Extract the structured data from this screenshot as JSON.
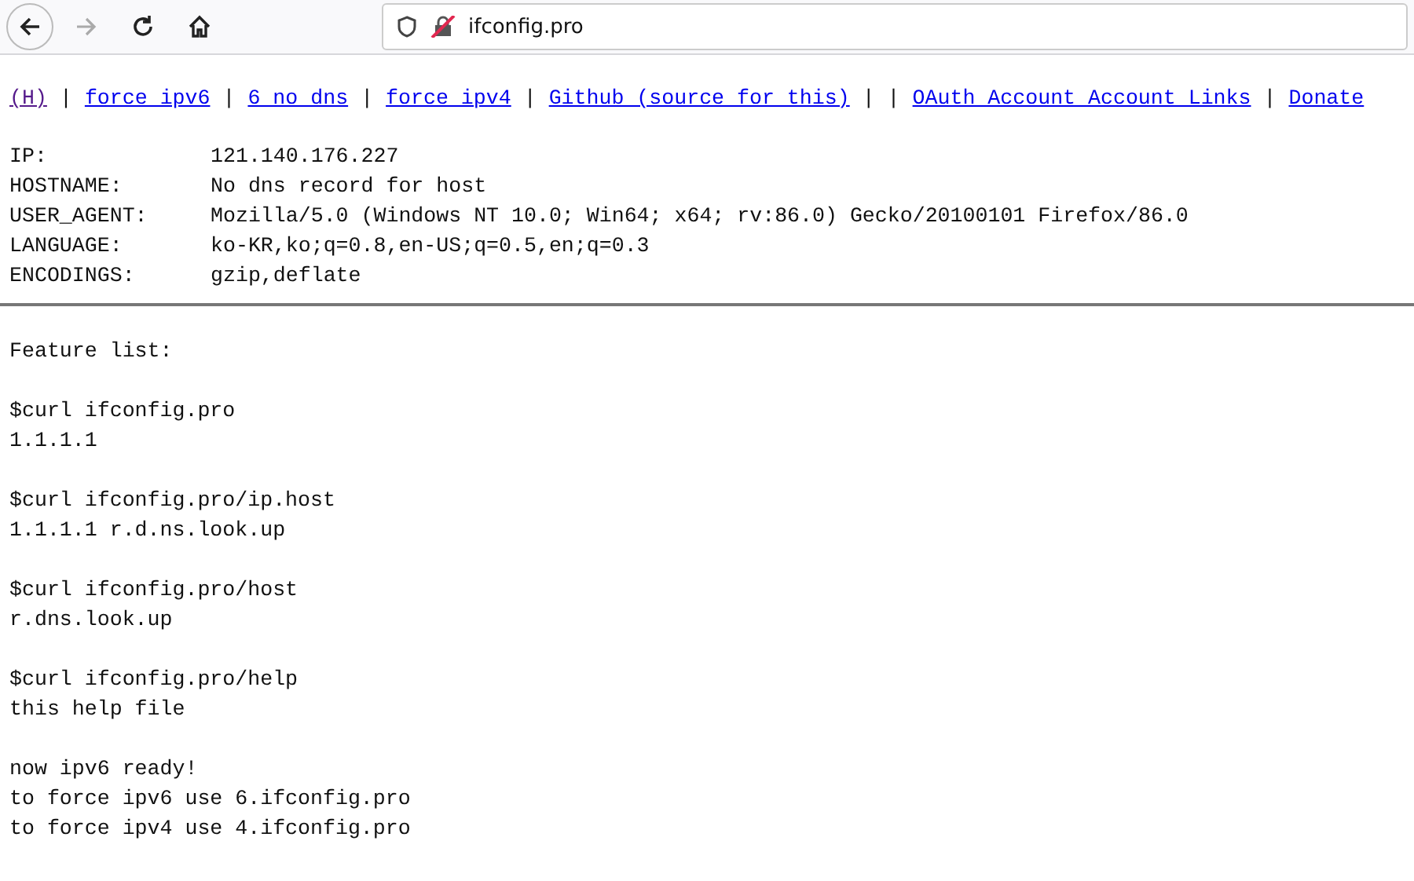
{
  "browser": {
    "address": "ifconfig.pro"
  },
  "nav": [
    {
      "kind": "link",
      "text": "(H)",
      "visited": true
    },
    {
      "kind": "separator",
      "text": "|"
    },
    {
      "kind": "link",
      "text": "force ipv6",
      "visited": false
    },
    {
      "kind": "separator",
      "text": "|"
    },
    {
      "kind": "link",
      "text": "6 no dns",
      "visited": false
    },
    {
      "kind": "separator",
      "text": "|"
    },
    {
      "kind": "link",
      "text": "force ipv4",
      "visited": false
    },
    {
      "kind": "separator",
      "text": "|"
    },
    {
      "kind": "link",
      "text": "Github (source for this)",
      "visited": false
    },
    {
      "kind": "separator",
      "text": "| |"
    },
    {
      "kind": "link",
      "text": "OAuth Account Account Links",
      "visited": false
    },
    {
      "kind": "separator",
      "text": "|"
    },
    {
      "kind": "link",
      "text": "Donate",
      "visited": false
    }
  ],
  "info": [
    {
      "label": "IP:",
      "value": "121.140.176.227"
    },
    {
      "label": "HOSTNAME:",
      "value": "No dns record for host"
    },
    {
      "label": "USER_AGENT:",
      "value": "Mozilla/5.0 (Windows NT 10.0; Win64; x64; rv:86.0) Gecko/20100101 Firefox/86.0"
    },
    {
      "label": "LANGUAGE:",
      "value": "ko-KR,ko;q=0.8,en-US;q=0.5,en;q=0.3"
    },
    {
      "label": "ENCODINGS:",
      "value": "gzip,deflate"
    }
  ],
  "features": [
    [
      "Feature list:"
    ],
    [
      "$curl ifconfig.pro",
      "1.1.1.1"
    ],
    [
      "$curl ifconfig.pro/ip.host",
      "1.1.1.1 r.d.ns.look.up"
    ],
    [
      "$curl ifconfig.pro/host",
      "r.dns.look.up"
    ],
    [
      "$curl ifconfig.pro/help",
      "this help file"
    ],
    [
      "now ipv6 ready!",
      "to force ipv6 use 6.ifconfig.pro",
      "to force ipv4 use 4.ifconfig.pro"
    ]
  ]
}
